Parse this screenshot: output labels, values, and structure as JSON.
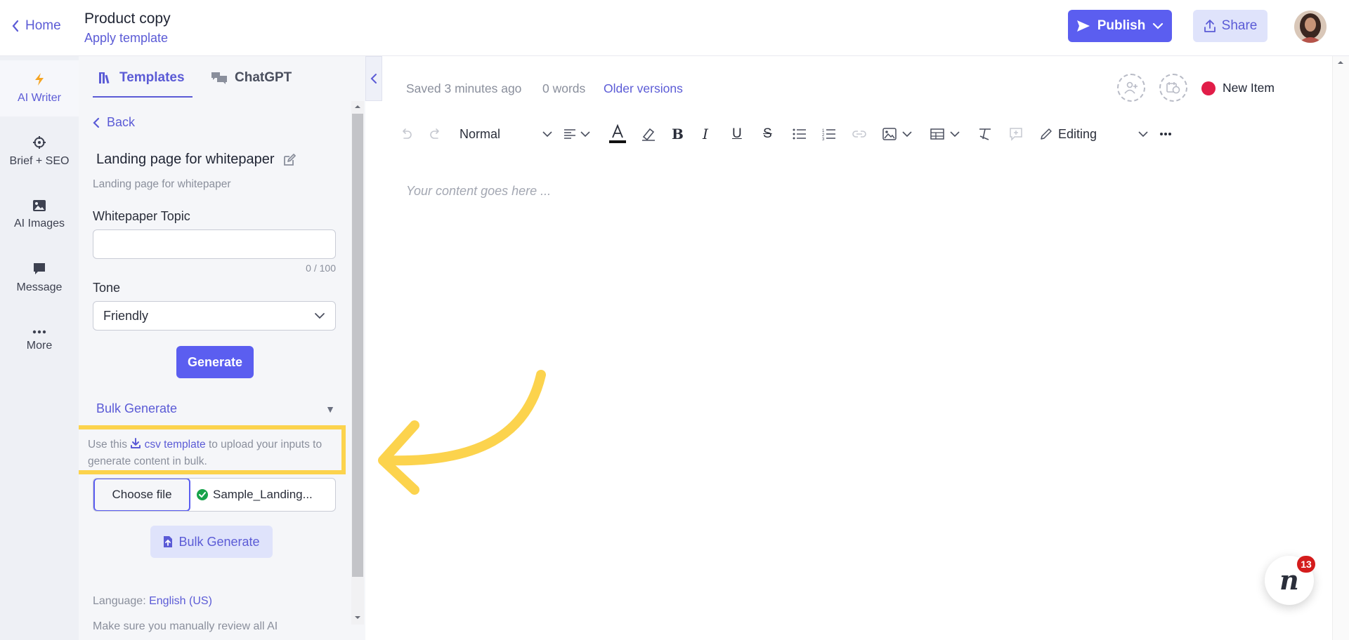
{
  "header": {
    "home_label": "Home",
    "doc_title": "Product copy",
    "apply_template": "Apply template",
    "publish_label": "Publish",
    "share_label": "Share",
    "avatar_icon": "user-avatar"
  },
  "rail": {
    "items": [
      {
        "label": "AI Writer",
        "icon": "lightning-icon"
      },
      {
        "label": "Brief + SEO",
        "icon": "crosshair-icon"
      },
      {
        "label": "AI Images",
        "icon": "image-icon"
      },
      {
        "label": "Message",
        "icon": "chat-bubble-icon"
      },
      {
        "label": "More",
        "icon": "ellipsis-icon"
      }
    ]
  },
  "panel": {
    "tabs": {
      "templates": "Templates",
      "chatgpt": "ChatGPT"
    },
    "back_label": "Back",
    "template_name": "Landing page for whitepaper",
    "template_desc": "Landing page for whitepaper",
    "topic_label": "Whitepaper Topic",
    "topic_value": "",
    "topic_count": "0 / 100",
    "tone_label": "Tone",
    "tone_value": "Friendly",
    "generate_label": "Generate",
    "bulk_label": "Bulk Generate",
    "bulk_caret": "▼",
    "bulk_note_pre": "Use this",
    "bulk_note_link": "csv template",
    "bulk_note_post": "to upload your inputs to generate content in bulk.",
    "choose_file_label": "Choose file",
    "file_name": "Sample_Landing...",
    "bulk_button_label": "Bulk Generate",
    "language_label": "Language:",
    "language_value": "English (US)",
    "disclaimer": "Make sure you manually review all AI"
  },
  "editor": {
    "saved": "Saved 3 minutes ago",
    "words": "0 words",
    "older_versions": "Older versions",
    "status_label": "New Item",
    "status_color": "#e11d48",
    "format_value": "Normal",
    "mode_value": "Editing",
    "placeholder": "Your content goes here ..."
  },
  "chat": {
    "glyph": "n",
    "badge": "13"
  },
  "colors": {
    "accent": "#5b5ef0",
    "link": "#5b5bd6",
    "highlight_annotation": "#fcd34d"
  }
}
